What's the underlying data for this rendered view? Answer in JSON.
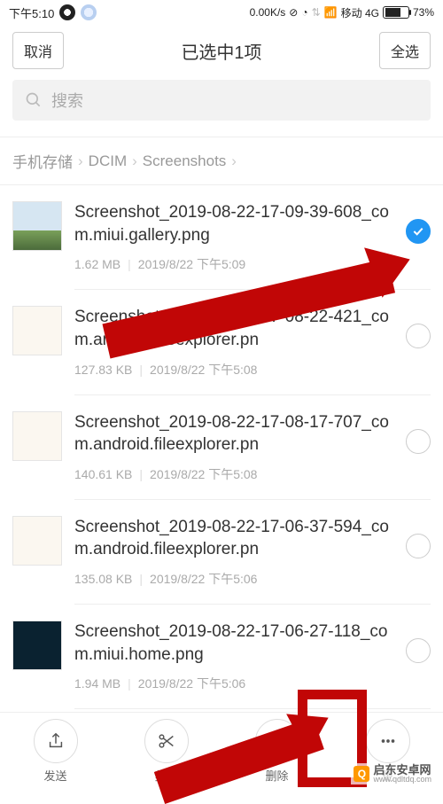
{
  "status": {
    "time": "下午5:10",
    "net_speed": "0.00K/s",
    "carrier": "移动 4G",
    "battery": "73%"
  },
  "header": {
    "cancel": "取消",
    "title": "已选中1项",
    "select_all": "全选"
  },
  "search": {
    "placeholder": "搜索"
  },
  "breadcrumb": [
    "手机存储",
    "DCIM",
    "Screenshots"
  ],
  "files": [
    {
      "name": "Screenshot_2019-08-22-17-09-39-608_com.miui.gallery.png",
      "size": "1.62 MB",
      "date": "2019/8/22 下午5:09",
      "selected": true,
      "thumb": "landscape"
    },
    {
      "name": "Screenshot_2019-08-22-17-08-22-421_com.android.fileexplorer.pn",
      "size": "127.83 KB",
      "date": "2019/8/22 下午5:08",
      "selected": false,
      "thumb": "app"
    },
    {
      "name": "Screenshot_2019-08-22-17-08-17-707_com.android.fileexplorer.pn",
      "size": "140.61 KB",
      "date": "2019/8/22 下午5:08",
      "selected": false,
      "thumb": "app"
    },
    {
      "name": "Screenshot_2019-08-22-17-06-37-594_com.android.fileexplorer.pn",
      "size": "135.08 KB",
      "date": "2019/8/22 下午5:06",
      "selected": false,
      "thumb": "app"
    },
    {
      "name": "Screenshot_2019-08-22-17-06-27-118_com.miui.home.png",
      "size": "1.94 MB",
      "date": "2019/8/22 下午5:06",
      "selected": false,
      "thumb": "dark"
    }
  ],
  "bottom": {
    "send": "发送",
    "cut": "剪切",
    "delete": "删除",
    "more": "更"
  },
  "watermark": {
    "text": "启东安卓网",
    "url": "www.qdltdq.com"
  }
}
